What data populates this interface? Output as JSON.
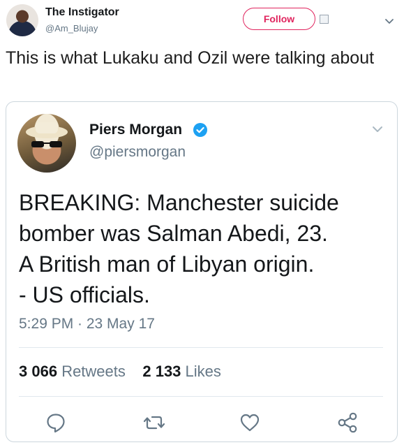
{
  "tweet": {
    "author_name": "The Instigator",
    "author_handle": "@Am_Blujay",
    "follow_label": "Follow",
    "text": "This is what Lukaku and Ozil were talking about"
  },
  "quoted": {
    "author_name": "Piers Morgan",
    "author_handle": "@piersmorgan",
    "verified": true,
    "text_lines": [
      "BREAKING: Manchester suicide",
      "bomber was Salman Abedi, 23.",
      "A British man of Libyan origin.",
      "- US officials."
    ],
    "timestamp": "5:29 PM · 23 May 17",
    "retweets_count": "3 066",
    "retweets_label": "Retweets",
    "likes_count": "2 133",
    "likes_label": "Likes"
  },
  "colors": {
    "follow_accent": "#e0245e",
    "verified": "#1da1f2",
    "muted": "#657786"
  },
  "icons": [
    "caret-down-icon",
    "broken-image-icon",
    "verified-badge-icon",
    "reply-icon",
    "retweet-icon",
    "like-icon",
    "share-icon"
  ]
}
